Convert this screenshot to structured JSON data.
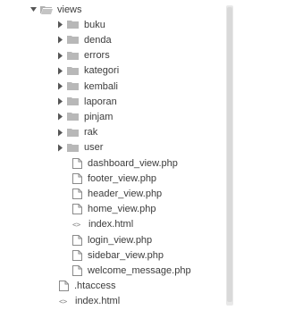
{
  "tree": {
    "root": {
      "label": "views"
    },
    "folders": [
      {
        "label": "buku"
      },
      {
        "label": "denda"
      },
      {
        "label": "errors"
      },
      {
        "label": "kategori"
      },
      {
        "label": "kembali"
      },
      {
        "label": "laporan"
      },
      {
        "label": "pinjam"
      },
      {
        "label": "rak"
      },
      {
        "label": "user"
      }
    ],
    "files": [
      {
        "label": "dashboard_view.php",
        "icon": "file-icon"
      },
      {
        "label": "footer_view.php",
        "icon": "file-icon"
      },
      {
        "label": "header_view.php",
        "icon": "file-icon"
      },
      {
        "label": "home_view.php",
        "icon": "file-icon"
      },
      {
        "label": "index.html",
        "icon": "code-icon"
      },
      {
        "label": "login_view.php",
        "icon": "file-icon"
      },
      {
        "label": "sidebar_view.php",
        "icon": "file-icon"
      },
      {
        "label": "welcome_message.php",
        "icon": "file-icon"
      }
    ],
    "sibling_files": [
      {
        "label": ".htaccess",
        "icon": "file-icon"
      },
      {
        "label": "index.html",
        "icon": "code-icon"
      }
    ]
  },
  "colors": {
    "folder": "#b8b8b8",
    "arrow": "#555555",
    "file_outline": "#8a8a8a"
  }
}
